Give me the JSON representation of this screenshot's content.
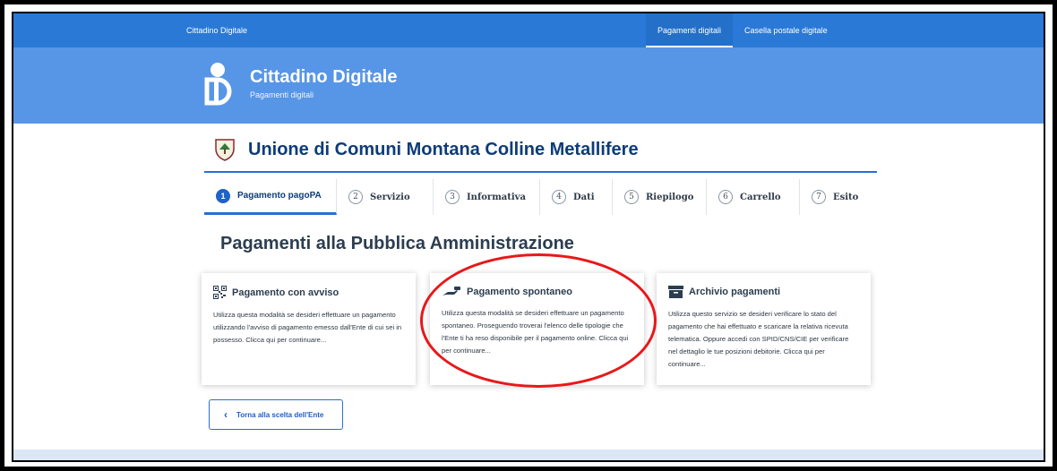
{
  "topbar": {
    "brand": "Cittadino Digitale",
    "nav": [
      "Pagamenti digitali",
      "Casella postale digitale"
    ]
  },
  "header": {
    "title": "Cittadino Digitale",
    "subtitle": "Pagamenti digitali"
  },
  "ente": {
    "name": "Unione di Comuni Montana Colline Metallifere"
  },
  "steps": [
    {
      "num": "1",
      "label": "Pagamento pagoPA"
    },
    {
      "num": "2",
      "label": "Servizio"
    },
    {
      "num": "3",
      "label": "Informativa"
    },
    {
      "num": "4",
      "label": "Dati"
    },
    {
      "num": "5",
      "label": "Riepilogo"
    },
    {
      "num": "6",
      "label": "Carrello"
    },
    {
      "num": "7",
      "label": "Esito"
    }
  ],
  "page_title": "Pagamenti alla Pubblica Amministrazione",
  "cards": [
    {
      "icon": "qr-code-icon",
      "title": "Pagamento con avviso",
      "text": "Utilizza questa modalità se desideri effettuare un pagamento utilizzando l'avviso di pagamento emesso dall'Ente di cui sei in possesso. Clicca qui per continuare..."
    },
    {
      "icon": "payment-icon",
      "title": "Pagamento spontaneo",
      "text": "Utilizza questa modalità se desideri effettuare un pagamento spontaneo. Proseguendo troverai l'elenco delle tipologie che l'Ente ti ha reso disponibile per il pagamento online. Clicca qui per continuare..."
    },
    {
      "icon": "archive-icon",
      "title": "Archivio pagamenti",
      "text": "Utilizza questo servizio se desideri verificare lo stato del pagamento che hai effettuato e scaricare la relativa ricevuta telematica. Oppure accedi con SPID/CNS/CIE per verificare nel dettaglio le tue posizioni debitorie. Clicca qui per continuare..."
    }
  ],
  "back_button": "Torna alla scelta dell'Ente",
  "colors": {
    "topbar": "#2a79d7",
    "header": "#5796e6",
    "accent": "#2a6fd1",
    "highlight": "#e8181a"
  }
}
